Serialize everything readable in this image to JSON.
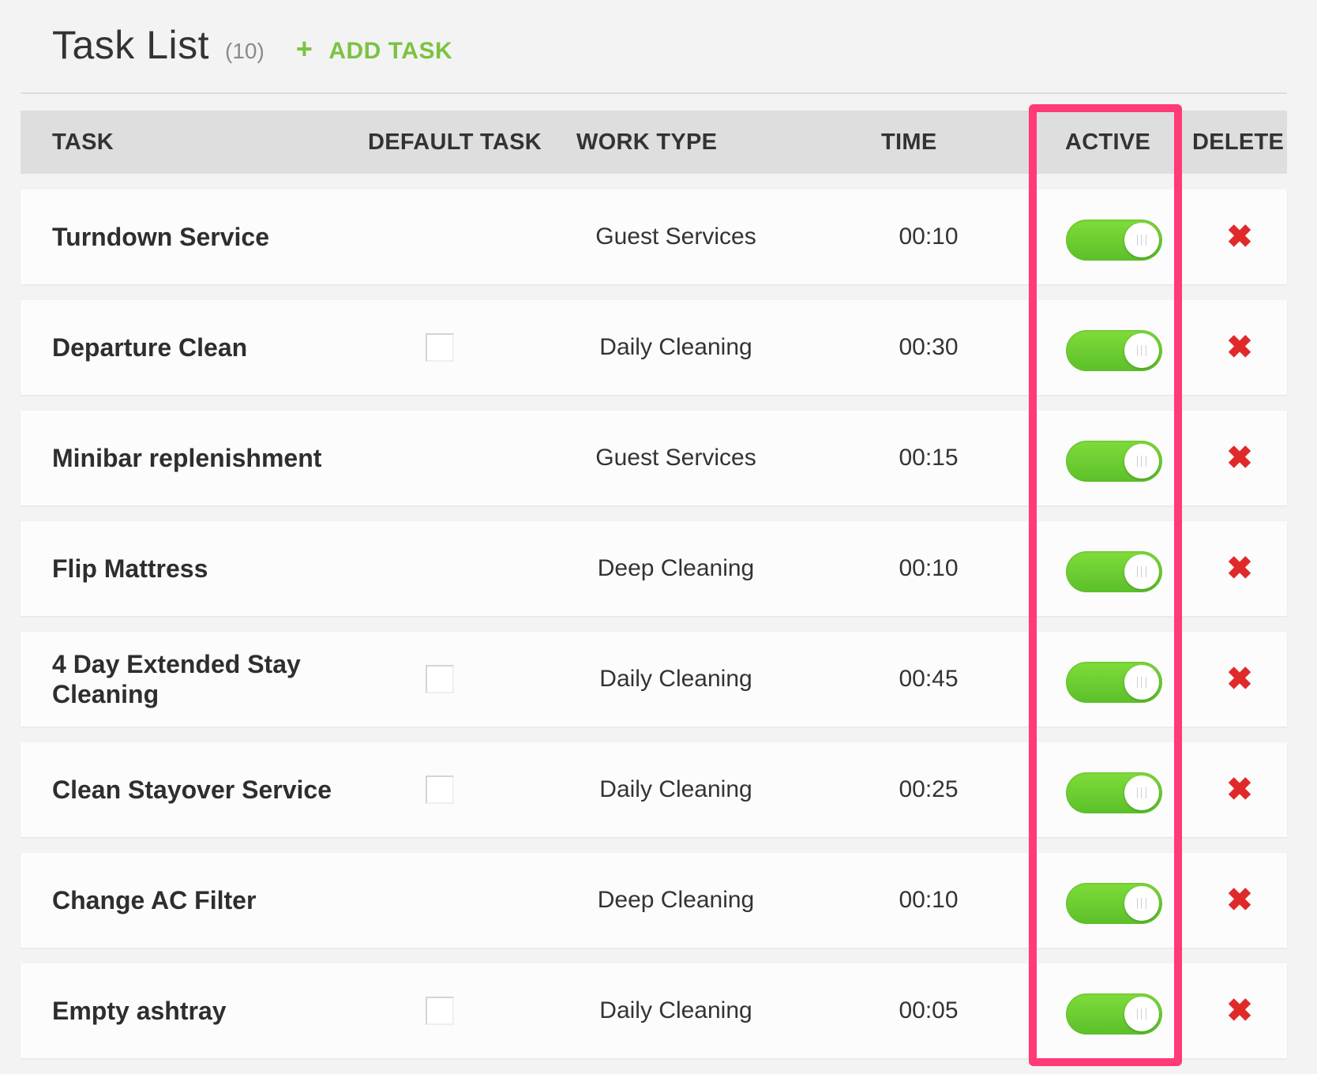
{
  "header": {
    "title": "Task List",
    "count": "(10)",
    "add_task_label": "ADD TASK",
    "add_task_icon": "plus-icon"
  },
  "columns": {
    "task": "TASK",
    "default_task": "DEFAULT TASK",
    "work_type": "WORK TYPE",
    "time": "TIME",
    "active": "ACTIVE",
    "delete": "DELETE"
  },
  "colors": {
    "accent_green": "#7cc242",
    "toggle_on": "#6fd232",
    "delete_red": "#e02a2a",
    "highlight_pink": "#ff3a77"
  },
  "tasks": [
    {
      "name": "Turndown Service",
      "has_default_checkbox": false,
      "default_checked": false,
      "work_type": "Guest Services",
      "time": "00:10",
      "active": true
    },
    {
      "name": "Departure Clean",
      "has_default_checkbox": true,
      "default_checked": false,
      "work_type": "Daily Cleaning",
      "time": "00:30",
      "active": true
    },
    {
      "name": "Minibar replenishment",
      "has_default_checkbox": false,
      "default_checked": false,
      "work_type": "Guest Services",
      "time": "00:15",
      "active": true
    },
    {
      "name": "Flip Mattress",
      "has_default_checkbox": false,
      "default_checked": false,
      "work_type": "Deep Cleaning",
      "time": "00:10",
      "active": true
    },
    {
      "name": "4 Day Extended Stay Cleaning",
      "has_default_checkbox": true,
      "default_checked": false,
      "work_type": "Daily Cleaning",
      "time": "00:45",
      "active": true
    },
    {
      "name": "Clean Stayover Service",
      "has_default_checkbox": true,
      "default_checked": false,
      "work_type": "Daily Cleaning",
      "time": "00:25",
      "active": true
    },
    {
      "name": "Change AC Filter",
      "has_default_checkbox": false,
      "default_checked": false,
      "work_type": "Deep Cleaning",
      "time": "00:10",
      "active": true
    },
    {
      "name": "Empty ashtray",
      "has_default_checkbox": true,
      "default_checked": false,
      "work_type": "Daily Cleaning",
      "time": "00:05",
      "active": true
    }
  ]
}
